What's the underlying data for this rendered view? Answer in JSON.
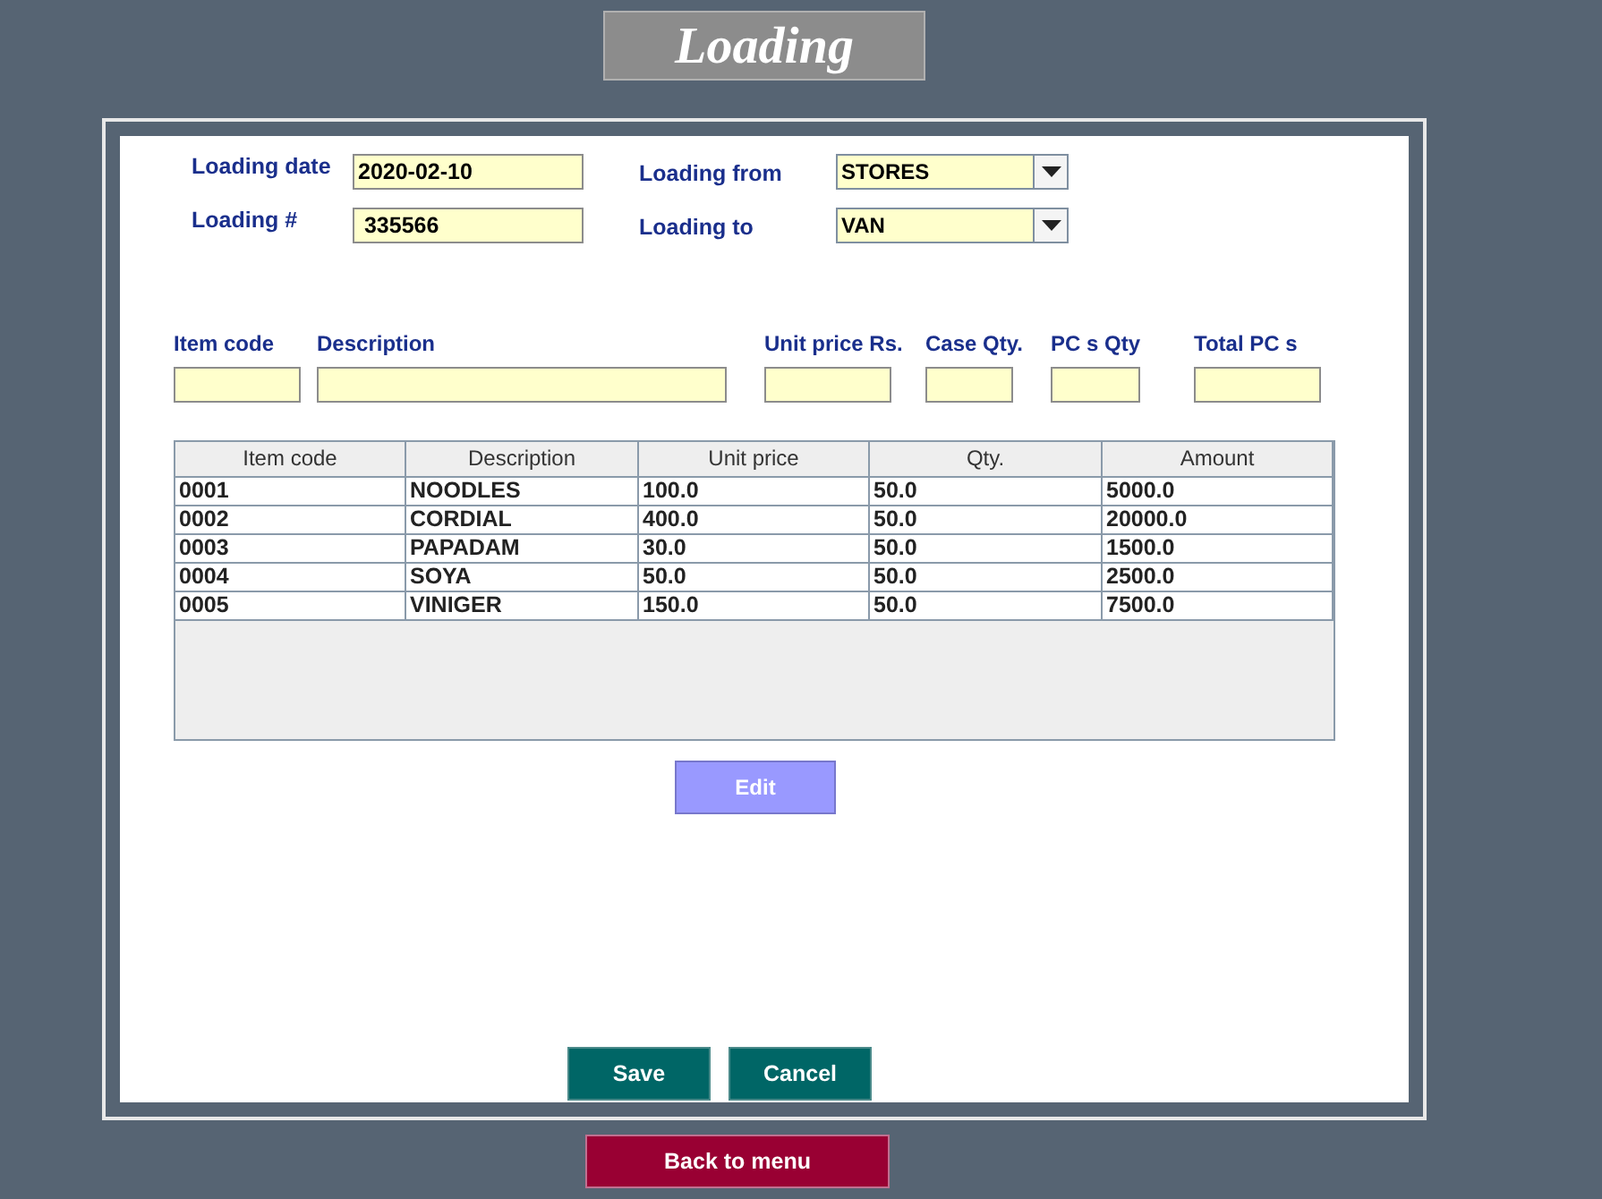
{
  "title": "Loading",
  "header_fields": [
    {
      "label": "Loading date",
      "value": "2020-02-10",
      "kind": "text"
    },
    {
      "label": "Loading from",
      "value": "STORES",
      "kind": "combo"
    },
    {
      "label": "Loading #",
      "value": " 335566",
      "kind": "text"
    },
    {
      "label": "Loading to",
      "value": "VAN",
      "kind": "combo"
    }
  ],
  "item_fields": [
    {
      "label": "Item code"
    },
    {
      "label": "Description"
    },
    {
      "label": "Unit price Rs."
    },
    {
      "label": "Case Qty."
    },
    {
      "label": "PC s Qty"
    },
    {
      "label": "Total PC s"
    }
  ],
  "table": {
    "columns": [
      "Item code",
      "Description",
      "Unit price",
      "Qty.",
      "Amount"
    ],
    "rows": [
      [
        "0001",
        "NOODLES",
        "100.0",
        "50.0",
        "5000.0"
      ],
      [
        "0002",
        "CORDIAL",
        "400.0",
        "50.0",
        "20000.0"
      ],
      [
        "0003",
        "PAPADAM",
        "30.0",
        "50.0",
        "1500.0"
      ],
      [
        "0004",
        "SOYA",
        "50.0",
        "50.0",
        "2500.0"
      ],
      [
        "0005",
        "VINIGER",
        "150.0",
        "50.0",
        "7500.0"
      ]
    ]
  },
  "edit_button": "Edit",
  "buttons": [
    "Save",
    "Cancel"
  ],
  "back_button": "Back to menu"
}
